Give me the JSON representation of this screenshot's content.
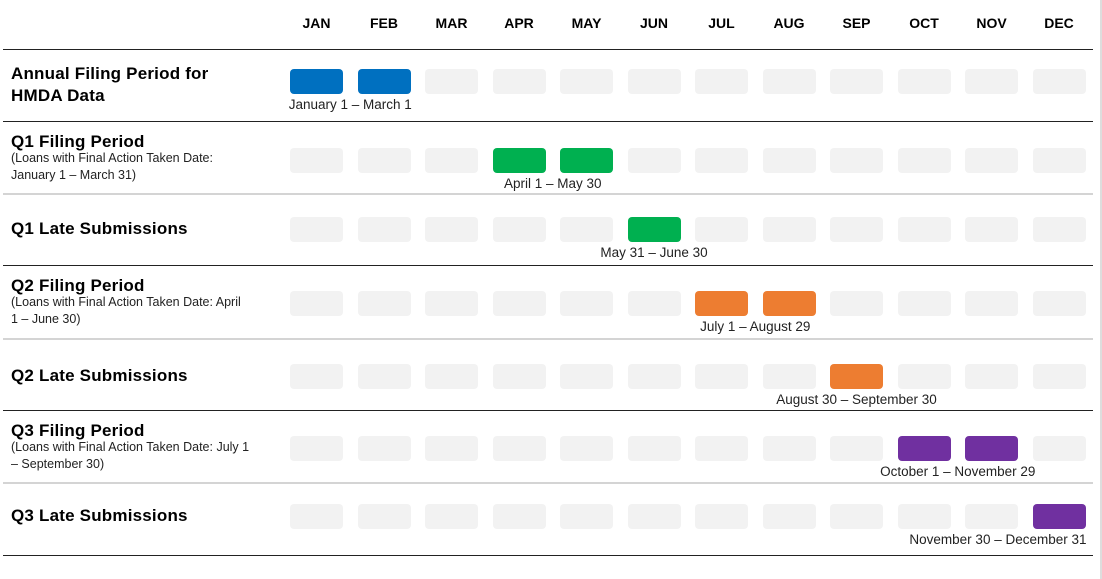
{
  "months": [
    "JAN",
    "FEB",
    "MAR",
    "APR",
    "MAY",
    "JUN",
    "JUL",
    "AUG",
    "SEP",
    "OCT",
    "NOV",
    "DEC"
  ],
  "colors": {
    "empty": "#f2f2f2",
    "annual": "#0070c0",
    "q1": "#00b050",
    "q2": "#ed7d31",
    "q3": "#7030a0"
  },
  "rows": [
    {
      "title": "Annual Filing Period for HMDA Data",
      "subtitle": "",
      "color": "#0070c0",
      "start": 0,
      "end": 1,
      "range": "January 1 – March 1"
    },
    {
      "title": "Q1 Filing Period",
      "subtitle": "(Loans with Final Action Taken Date: January 1 – March 31)",
      "color": "#00b050",
      "start": 3,
      "end": 4,
      "range": "April 1 – May 30"
    },
    {
      "title": "Q1 Late Submissions",
      "subtitle": "",
      "color": "#00b050",
      "start": 5,
      "end": 5,
      "range": "May 31 – June 30"
    },
    {
      "title": "Q2 Filing Period",
      "subtitle": "(Loans with Final Action Taken Date: April 1 – June 30)",
      "color": "#ed7d31",
      "start": 6,
      "end": 7,
      "range": "July 1 – August 29"
    },
    {
      "title": "Q2 Late Submissions",
      "subtitle": "",
      "color": "#ed7d31",
      "start": 8,
      "end": 8,
      "range": "August 30 – September 30"
    },
    {
      "title": "Q3 Filing Period",
      "subtitle": "(Loans with Final Action Taken Date: July 1 – September 30)",
      "color": "#7030a0",
      "start": 9,
      "end": 10,
      "range": "October 1 – November 29"
    },
    {
      "title": "Q3 Late Submissions",
      "subtitle": "",
      "color": "#7030a0",
      "start": 11,
      "end": 11,
      "range": "November 30 – December 31"
    }
  ]
}
